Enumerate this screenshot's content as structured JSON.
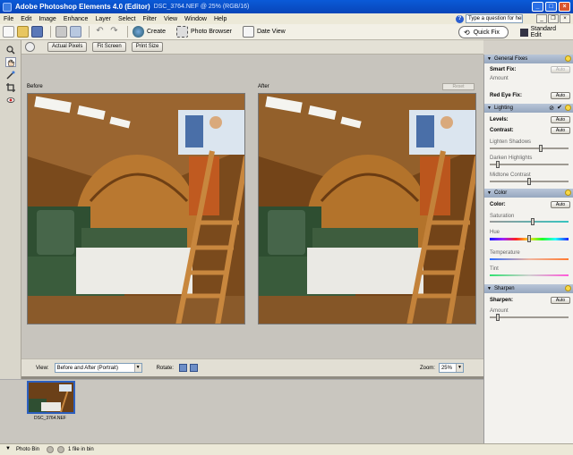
{
  "titlebar": {
    "title": "Adobe Photoshop Elements 4.0 (Editor)",
    "file": "DSC_3764.NEF @ 25% (RGB/16)"
  },
  "menu": [
    "File",
    "Edit",
    "Image",
    "Enhance",
    "Layer",
    "Select",
    "Filter",
    "View",
    "Window",
    "Help"
  ],
  "help": {
    "placeholder": "Type a question for help"
  },
  "shortcuts": {
    "create": "Create",
    "photo_browser": "Photo Browser",
    "date_view": "Date View"
  },
  "modes": {
    "quick_fix": "Quick Fix",
    "standard_edit": "Standard Edit"
  },
  "options": {
    "actual_pixels": "Actual Pixels",
    "fit_screen": "Fit Screen",
    "print_size": "Print Size"
  },
  "panes": {
    "before": "Before",
    "after": "After",
    "reset": "Reset"
  },
  "viewbar": {
    "view_label": "View:",
    "view_value": "Before and After (Portrait)",
    "rotate_label": "Rotate:",
    "zoom_label": "Zoom:",
    "zoom_value": "25%"
  },
  "bin": {
    "thumb_name": "DSC_3764.NEF"
  },
  "status": {
    "photo_bin": "Photo Bin",
    "count": "1 file in bin"
  },
  "palette": {
    "general": {
      "title": "General Fixes",
      "smart_fix": "Smart Fix:",
      "amount": "Amount",
      "red_eye": "Red Eye Fix:",
      "auto": "Auto"
    },
    "lighting": {
      "title": "Lighting",
      "levels": "Levels:",
      "contrast": "Contrast:",
      "auto": "Auto",
      "lighten": "Lighten Shadows",
      "darken": "Darken Highlights",
      "midtone": "Midtone Contrast"
    },
    "color": {
      "title": "Color",
      "color": "Color:",
      "auto": "Auto",
      "saturation": "Saturation",
      "hue": "Hue",
      "temperature": "Temperature",
      "tint": "Tint"
    },
    "sharpen": {
      "title": "Sharpen",
      "sharpen": "Sharpen:",
      "auto": "Auto",
      "amount": "Amount"
    }
  },
  "colors": {
    "accent": "#0845b8",
    "section_header": "#96a7bf",
    "selection": "#2c5fbf"
  },
  "slider_levels": {
    "lighten": 0.65,
    "darken": 0.08,
    "midtone": 0.5,
    "saturation": 0.55,
    "hue": 0.5,
    "sharpen_amount": 0.08
  }
}
